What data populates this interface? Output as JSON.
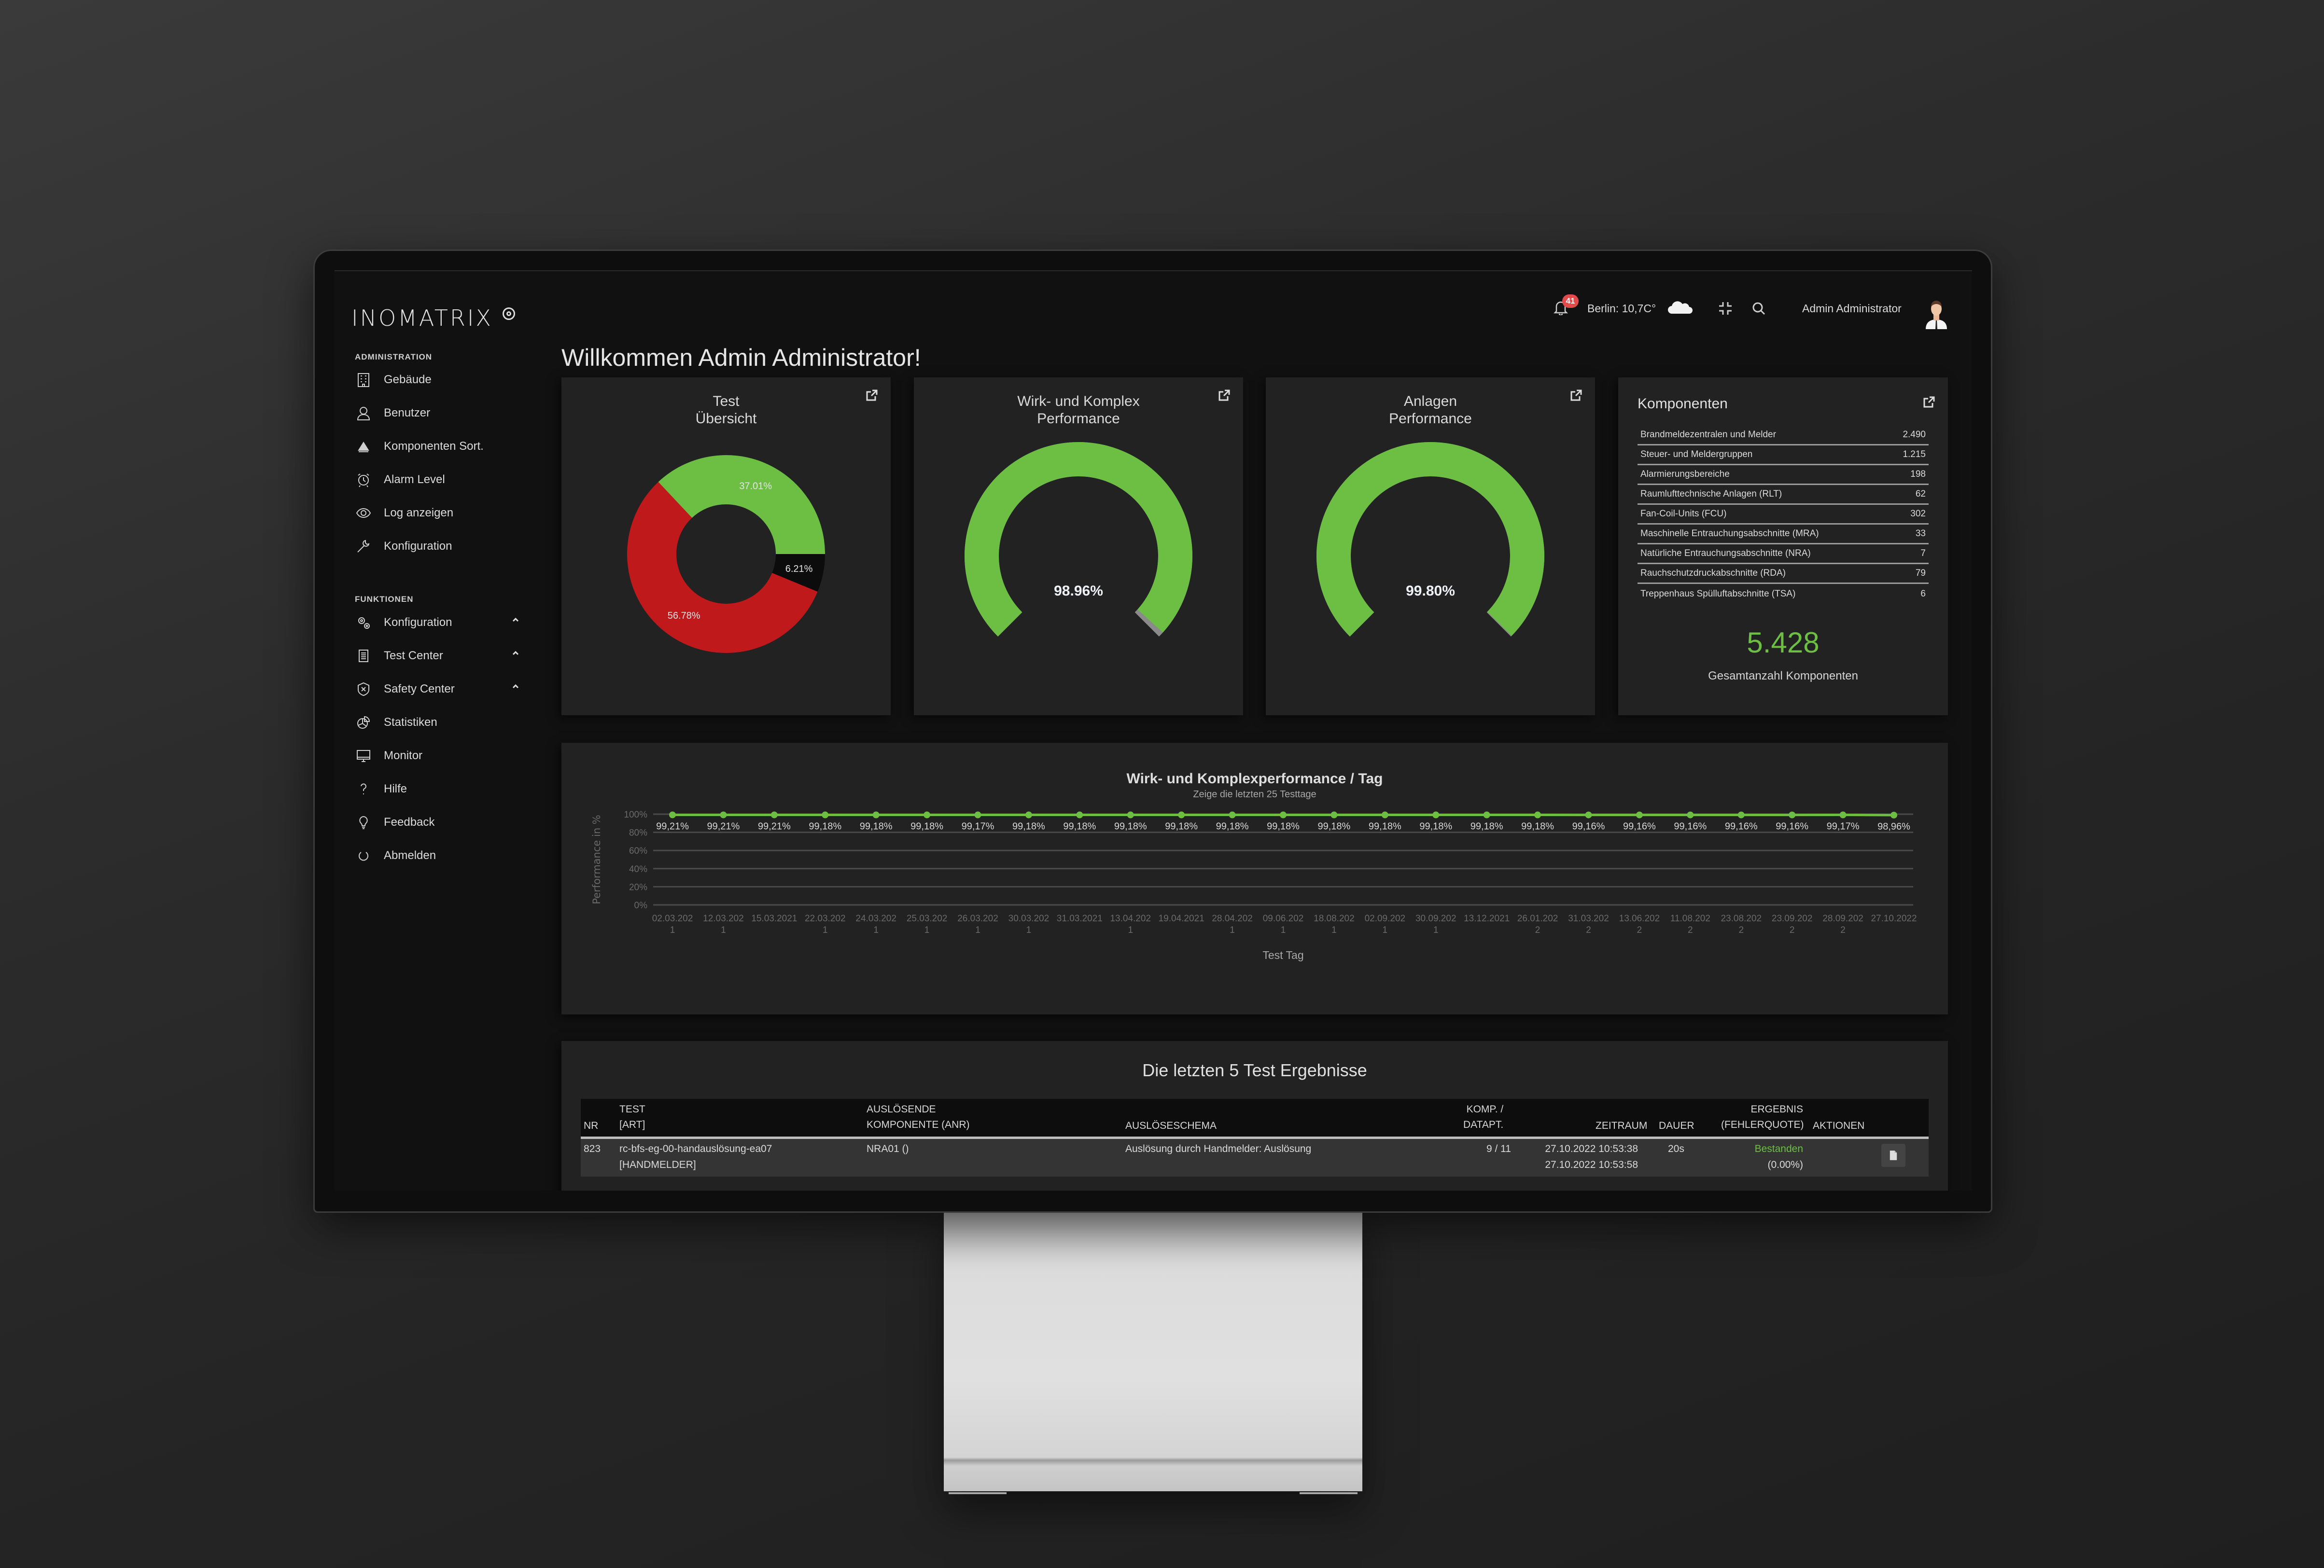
{
  "app": {
    "logo": "INOMATRIX",
    "welcome": "Willkommen Admin Administrator!"
  },
  "header": {
    "notification_count": "41",
    "weather": "Berlin: 10,7C°",
    "weather_icon": "cloud-icon",
    "user_name": "Admin Administrator"
  },
  "sidebar": {
    "admin_section": "ADMINISTRATION",
    "admin_items": [
      {
        "label": "Gebäude",
        "icon": "building-icon"
      },
      {
        "label": "Benutzer",
        "icon": "user-icon"
      },
      {
        "label": "Komponenten Sort.",
        "icon": "stack-icon"
      },
      {
        "label": "Alarm Level",
        "icon": "alarm-clock-icon"
      },
      {
        "label": "Log anzeigen",
        "icon": "eye-icon"
      },
      {
        "label": "Konfiguration",
        "icon": "wrench-icon"
      }
    ],
    "func_section": "FUNKTIONEN",
    "func_items": [
      {
        "label": "Konfiguration",
        "icon": "gears-icon",
        "expandable": true
      },
      {
        "label": "Test Center",
        "icon": "document-icon",
        "expandable": true
      },
      {
        "label": "Safety Center",
        "icon": "shield-icon",
        "expandable": true
      },
      {
        "label": "Statistiken",
        "icon": "pie-chart-icon",
        "expandable": false
      },
      {
        "label": "Monitor",
        "icon": "monitor-icon",
        "expandable": false
      },
      {
        "label": "Hilfe",
        "icon": "question-icon",
        "expandable": false
      },
      {
        "label": "Feedback",
        "icon": "lightbulb-icon",
        "expandable": false
      },
      {
        "label": "Abmelden",
        "icon": "power-icon",
        "expandable": false
      }
    ]
  },
  "cards": {
    "test": {
      "title_1": "Test",
      "title_2": "Übersicht"
    },
    "wirk": {
      "title_1": "Wirk- und Komplex",
      "title_2": "Performance",
      "value_label": "98.96%"
    },
    "anlagen": {
      "title_1": "Anlagen",
      "title_2": "Performance",
      "value_label": "99.80%"
    },
    "komponenten": {
      "title": "Komponenten",
      "rows": [
        {
          "label": "Brandmeldezentralen und Melder",
          "value": "2.490"
        },
        {
          "label": "Steuer- und Meldergruppen",
          "value": "1.215"
        },
        {
          "label": "Alarmierungsbereiche",
          "value": "198"
        },
        {
          "label": "Raumlufttechnische Anlagen (RLT)",
          "value": "62"
        },
        {
          "label": "Fan-Coil-Units (FCU)",
          "value": "302"
        },
        {
          "label": "Maschinelle Entrauchungsabschnitte (MRA)",
          "value": "33"
        },
        {
          "label": "Natürliche Entrauchungsabschnitte (NRA)",
          "value": "7"
        },
        {
          "label": "Rauchschutzdruckabschnitte (RDA)",
          "value": "79"
        },
        {
          "label": "Treppenhaus Spülluftabschnitte (TSA)",
          "value": "6"
        }
      ],
      "total": "5.428",
      "total_label": "Gesamtanzahl Komponenten"
    }
  },
  "colors": {
    "green": "#6cbf43",
    "red": "#c0191b",
    "black": "#0c0c0c",
    "gauge_rest": "#8a8a8a",
    "badge": "#e14b4b"
  },
  "table": {
    "title": "Die letzten 5 Test Ergebnisse",
    "headers": {
      "nr": "NR",
      "test_1": "TEST",
      "test_2": "[ART]",
      "comp_1": "AUSLÖSENDE",
      "comp_2": "KOMPONENTE (ANR)",
      "schema": "AUSLÖSESCHEMA",
      "kd_1": "KOMP. /",
      "kd_2": "DATAPT.",
      "zeitraum": "ZEITRAUM",
      "dauer": "DAUER",
      "erg_1": "ERGEBNIS",
      "erg_2": "(FEHLERQUOTE)",
      "aktionen": "AKTIONEN"
    },
    "rows": [
      {
        "nr": "823",
        "test": "rc-bfs-eg-00-handauslösung-ea07",
        "art": "[HANDMELDER]",
        "komponente": "NRA01 ()",
        "schema": "Auslösung durch Handmelder: Auslösung",
        "komp_datapt": "9 / 11",
        "start": "27.10.2022 10:53:38",
        "end": "27.10.2022 10:53:58",
        "dauer": "20s",
        "ergebnis": "Bestanden",
        "fehlerquote": "(0.00%)",
        "action_icon": "pdf-icon"
      }
    ]
  },
  "chart_data": [
    {
      "type": "pie",
      "title": "Test Übersicht",
      "variant": "donut",
      "slices": [
        {
          "label": "37.01%",
          "value": 37.01,
          "color": "#6cbf43"
        },
        {
          "label": "6.21%",
          "value": 6.21,
          "color": "#0c0c0c"
        },
        {
          "label": "56.78%",
          "value": 56.78,
          "color": "#c0191b"
        }
      ]
    },
    {
      "type": "gauge",
      "title": "Wirk- und Komplex Performance",
      "value": 98.96,
      "max": 100,
      "label": "98.96%"
    },
    {
      "type": "gauge",
      "title": "Anlagen Performance",
      "value": 99.8,
      "max": 100,
      "label": "99.80%"
    },
    {
      "type": "line",
      "title": "Wirk- und Komplexperformance / Tag",
      "subtitle": "Zeige die letzten 25 Testtage",
      "xlabel": "Test Tag",
      "ylabel": "Performance in %",
      "ylim": [
        0,
        100
      ],
      "yticks": [
        "0%",
        "20%",
        "40%",
        "60%",
        "80%",
        "100%"
      ],
      "grid": true,
      "x": [
        "02.03.2021",
        "12.03.2021",
        "15.03.2021",
        "22.03.2021",
        "24.03.2021",
        "25.03.2021",
        "26.03.2021",
        "30.03.2021",
        "31.03.2021",
        "13.04.2021",
        "19.04.2021",
        "28.04.2021",
        "09.06.2021",
        "18.08.2021",
        "02.09.2021",
        "30.09.2021",
        "13.12.2021",
        "26.01.2022",
        "31.03.2022",
        "13.06.2022",
        "11.08.2022",
        "23.08.2022",
        "23.09.2022",
        "28.09.2022",
        "27.10.2022"
      ],
      "values": [
        99.21,
        99.21,
        99.21,
        99.18,
        99.18,
        99.18,
        99.17,
        99.18,
        99.18,
        99.18,
        99.18,
        99.18,
        99.18,
        99.18,
        99.18,
        99.18,
        99.18,
        99.18,
        99.16,
        99.16,
        99.16,
        99.16,
        99.16,
        99.17,
        98.96
      ],
      "value_labels": [
        "99,21%",
        "99,21%",
        "99,21%",
        "99,18%",
        "99,18%",
        "99,18%",
        "99,17%",
        "99,18%",
        "99,18%",
        "99,18%",
        "99,18%",
        "99,18%",
        "99,18%",
        "99,18%",
        "99,18%",
        "99,18%",
        "99,18%",
        "99,18%",
        "99,16%",
        "99,16%",
        "99,16%",
        "99,16%",
        "99,16%",
        "99,17%",
        "98,96%"
      ]
    }
  ]
}
